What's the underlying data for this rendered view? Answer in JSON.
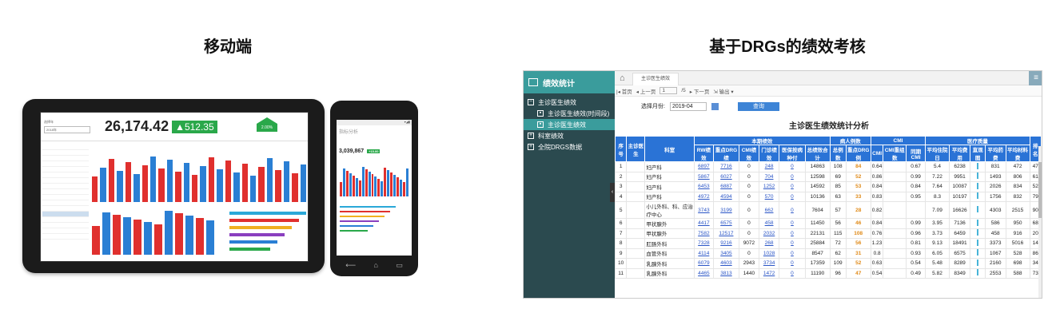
{
  "captions": {
    "left": "移动端",
    "right": "基于DRGs的绩效考核"
  },
  "colors": {
    "sidebar": "#2b4a4f",
    "accent": "#3a9c9c",
    "header_blue": "#2a73d6",
    "link": "#2a55c6",
    "orange": "#e08a18"
  },
  "tablet": {
    "select_label": "选择年",
    "select_value": "2018年",
    "big_number": "26,174.42",
    "change_badge": "▲512.35",
    "pct_badge": "2.00%",
    "side_items": [
      "",
      "",
      "",
      "",
      "",
      "",
      "",
      "",
      "",
      "",
      "",
      "",
      "",
      "",
      "",
      "",
      ""
    ]
  },
  "phone": {
    "title": "指标分析",
    "value": "3,039,867",
    "badge": "+15.00"
  },
  "app": {
    "sidebar": {
      "title": "绩效统计",
      "items": [
        {
          "label": "主诊医生绩效",
          "icon": "minus-box-icon"
        },
        {
          "label": "主诊医生绩效(时间段)",
          "icon": "report-icon"
        },
        {
          "label": "主诊医生绩效",
          "icon": "report-icon"
        },
        {
          "label": "科室绩效",
          "icon": "plus-box-icon"
        },
        {
          "label": "全院DRGS数据",
          "icon": "plus-box-icon"
        }
      ]
    },
    "tab": "主诊医生绩效",
    "toolbar": {
      "first": "首页",
      "prev": "上一页",
      "page": "1",
      "total": "/5",
      "next": "下一页",
      "export": "输出"
    },
    "filter": {
      "label": "选择月份:",
      "value": "2019-04",
      "query": "查询"
    },
    "report_title": "主诊医生绩效统计分析",
    "groups": [
      "本期绩效",
      "病人例数",
      "CMI",
      "医疗质量"
    ],
    "headers": [
      "序号",
      "主诊医生",
      "科室",
      "RW绩效",
      "重点DRG绩",
      "CMI绩效",
      "门诊绩效",
      "医保按病种付",
      "总绩效合计",
      "总例数",
      "重点DRG例",
      "CMI",
      "CMI重组数",
      "同期CMI",
      "平均住院日",
      "平均费用",
      "直观图",
      "平均药费",
      "平均材料费",
      "排名"
    ],
    "rows": [
      [
        "1",
        "",
        "妇产科",
        "6897",
        "7716",
        "0",
        "248",
        "0",
        "14863",
        "108",
        "84",
        "0.64",
        "",
        "0.67",
        "5.4",
        "6238",
        "",
        "831",
        "472",
        "47"
      ],
      [
        "2",
        "",
        "妇产科",
        "5867",
        "6027",
        "0",
        "704",
        "0",
        "12598",
        "69",
        "52",
        "0.86",
        "",
        "0.99",
        "7.22",
        "9951",
        "",
        "1493",
        "806",
        "61"
      ],
      [
        "3",
        "",
        "妇产科",
        "6453",
        "6887",
        "0",
        "1252",
        "0",
        "14592",
        "85",
        "53",
        "0.84",
        "",
        "0.84",
        "7.64",
        "10087",
        "",
        "2026",
        "834",
        "52"
      ],
      [
        "4",
        "",
        "妇产科",
        "4972",
        "4594",
        "0",
        "570",
        "0",
        "10136",
        "63",
        "33",
        "0.83",
        "",
        "0.95",
        "8.3",
        "10197",
        "",
        "1756",
        "832",
        "79"
      ],
      [
        "5",
        "",
        "小儿外科、科、应治疗中心",
        "3743",
        "3199",
        "0",
        "662",
        "0",
        "7604",
        "57",
        "28",
        "0.82",
        "",
        "",
        "7.09",
        "16626",
        "",
        "4303",
        "2515",
        "90"
      ],
      [
        "6",
        "",
        "甲状腺外",
        "4417",
        "6575",
        "0",
        "458",
        "0",
        "11450",
        "56",
        "46",
        "0.84",
        "",
        "0.99",
        "3.95",
        "7136",
        "",
        "586",
        "950",
        "68"
      ],
      [
        "7",
        "",
        "甲状腺外",
        "7582",
        "12517",
        "0",
        "2032",
        "0",
        "22131",
        "115",
        "108",
        "0.76",
        "",
        "0.96",
        "3.73",
        "6459",
        "",
        "458",
        "916",
        "20"
      ],
      [
        "8",
        "",
        "肛肠外科",
        "7328",
        "9216",
        "9072",
        "268",
        "0",
        "25884",
        "72",
        "56",
        "1.23",
        "",
        "0.81",
        "9.13",
        "18491",
        "",
        "3373",
        "5016",
        "14"
      ],
      [
        "9",
        "",
        "血管外科",
        "4114",
        "3405",
        "0",
        "1028",
        "0",
        "8547",
        "62",
        "31",
        "0.8",
        "",
        "0.93",
        "6.05",
        "6575",
        "",
        "1067",
        "528",
        "86"
      ],
      [
        "10",
        "",
        "乳腺外科",
        "6079",
        "4603",
        "2943",
        "3734",
        "0",
        "17359",
        "109",
        "52",
        "0.63",
        "",
        "0.54",
        "5.48",
        "8289",
        "",
        "2160",
        "698",
        "34"
      ],
      [
        "11",
        "",
        "乳腺外科",
        "4465",
        "3813",
        "1440",
        "1472",
        "0",
        "11190",
        "96",
        "47",
        "0.54",
        "",
        "0.49",
        "5.82",
        "8349",
        "",
        "2553",
        "588",
        "73"
      ]
    ]
  }
}
